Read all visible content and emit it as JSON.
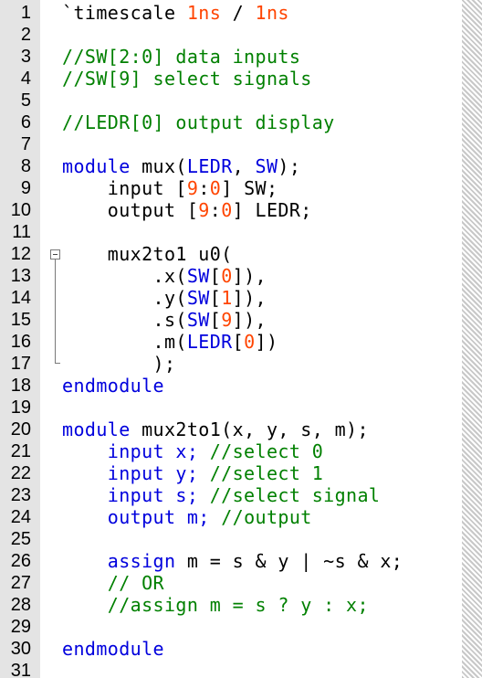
{
  "colors": {
    "keyword": "#0000dd",
    "comment": "#008000",
    "number": "#ff4400",
    "default": "#000000",
    "gutter": "#e4e4e4"
  },
  "lines": [
    {
      "n": "1",
      "tokens": [
        {
          "t": "`timescale ",
          "c": "default"
        },
        {
          "t": "1ns",
          "c": "number"
        },
        {
          "t": " / ",
          "c": "default"
        },
        {
          "t": "1ns",
          "c": "number"
        }
      ]
    },
    {
      "n": "2",
      "tokens": []
    },
    {
      "n": "3",
      "tokens": [
        {
          "t": "//SW[2:0] data inputs",
          "c": "comment"
        }
      ]
    },
    {
      "n": "4",
      "tokens": [
        {
          "t": "//SW[9] select signals",
          "c": "comment"
        }
      ]
    },
    {
      "n": "5",
      "tokens": []
    },
    {
      "n": "6",
      "tokens": [
        {
          "t": "//LEDR[0] output display",
          "c": "comment"
        }
      ]
    },
    {
      "n": "7",
      "tokens": []
    },
    {
      "n": "8",
      "tokens": [
        {
          "t": "module",
          "c": "keyword"
        },
        {
          "t": " mux(",
          "c": "default"
        },
        {
          "t": "LEDR",
          "c": "keyword"
        },
        {
          "t": ", ",
          "c": "default"
        },
        {
          "t": "SW",
          "c": "keyword"
        },
        {
          "t": ");",
          "c": "default"
        }
      ]
    },
    {
      "n": "9",
      "tokens": [
        {
          "t": "    input [",
          "c": "default"
        },
        {
          "t": "9",
          "c": "number"
        },
        {
          "t": ":",
          "c": "default"
        },
        {
          "t": "0",
          "c": "number"
        },
        {
          "t": "] SW;",
          "c": "default"
        }
      ]
    },
    {
      "n": "10",
      "tokens": [
        {
          "t": "    output [",
          "c": "default"
        },
        {
          "t": "9",
          "c": "number"
        },
        {
          "t": ":",
          "c": "default"
        },
        {
          "t": "0",
          "c": "number"
        },
        {
          "t": "] LEDR;",
          "c": "default"
        }
      ]
    },
    {
      "n": "11",
      "tokens": []
    },
    {
      "n": "12",
      "tokens": [
        {
          "t": "    mux2to1 u0(",
          "c": "default"
        }
      ]
    },
    {
      "n": "13",
      "tokens": [
        {
          "t": "        .x(",
          "c": "default"
        },
        {
          "t": "SW",
          "c": "keyword"
        },
        {
          "t": "[",
          "c": "default"
        },
        {
          "t": "0",
          "c": "number"
        },
        {
          "t": "]),",
          "c": "default"
        }
      ]
    },
    {
      "n": "14",
      "tokens": [
        {
          "t": "        .y(",
          "c": "default"
        },
        {
          "t": "SW",
          "c": "keyword"
        },
        {
          "t": "[",
          "c": "default"
        },
        {
          "t": "1",
          "c": "number"
        },
        {
          "t": "]),",
          "c": "default"
        }
      ]
    },
    {
      "n": "15",
      "tokens": [
        {
          "t": "        .s(",
          "c": "default"
        },
        {
          "t": "SW",
          "c": "keyword"
        },
        {
          "t": "[",
          "c": "default"
        },
        {
          "t": "9",
          "c": "number"
        },
        {
          "t": "]),",
          "c": "default"
        }
      ]
    },
    {
      "n": "16",
      "tokens": [
        {
          "t": "        .m(",
          "c": "default"
        },
        {
          "t": "LEDR",
          "c": "keyword"
        },
        {
          "t": "[",
          "c": "default"
        },
        {
          "t": "0",
          "c": "number"
        },
        {
          "t": "])",
          "c": "default"
        }
      ]
    },
    {
      "n": "17",
      "tokens": [
        {
          "t": "        );",
          "c": "default"
        }
      ]
    },
    {
      "n": "18",
      "tokens": [
        {
          "t": "endmodule",
          "c": "keyword"
        }
      ]
    },
    {
      "n": "19",
      "tokens": []
    },
    {
      "n": "20",
      "tokens": [
        {
          "t": "module",
          "c": "keyword"
        },
        {
          "t": " mux2to1(x, y, s, m);",
          "c": "default"
        }
      ]
    },
    {
      "n": "21",
      "tokens": [
        {
          "t": "    input x; ",
          "c": "keyword"
        },
        {
          "t": "//select 0",
          "c": "comment"
        }
      ]
    },
    {
      "n": "22",
      "tokens": [
        {
          "t": "    input y; ",
          "c": "keyword"
        },
        {
          "t": "//select 1",
          "c": "comment"
        }
      ]
    },
    {
      "n": "23",
      "tokens": [
        {
          "t": "    input s; ",
          "c": "keyword"
        },
        {
          "t": "//select signal",
          "c": "comment"
        }
      ]
    },
    {
      "n": "24",
      "tokens": [
        {
          "t": "    output m; ",
          "c": "keyword"
        },
        {
          "t": "//output",
          "c": "comment"
        }
      ]
    },
    {
      "n": "25",
      "tokens": []
    },
    {
      "n": "26",
      "tokens": [
        {
          "t": "    assign",
          "c": "keyword"
        },
        {
          "t": " m = s & y | ~s & x;",
          "c": "default"
        }
      ]
    },
    {
      "n": "27",
      "tokens": [
        {
          "t": "    // OR",
          "c": "comment"
        }
      ]
    },
    {
      "n": "28",
      "tokens": [
        {
          "t": "    //assign m = s ? y : x;",
          "c": "comment"
        }
      ]
    },
    {
      "n": "29",
      "tokens": []
    },
    {
      "n": "30",
      "tokens": [
        {
          "t": "endmodule",
          "c": "keyword"
        }
      ]
    },
    {
      "n": "31",
      "tokens": []
    }
  ]
}
